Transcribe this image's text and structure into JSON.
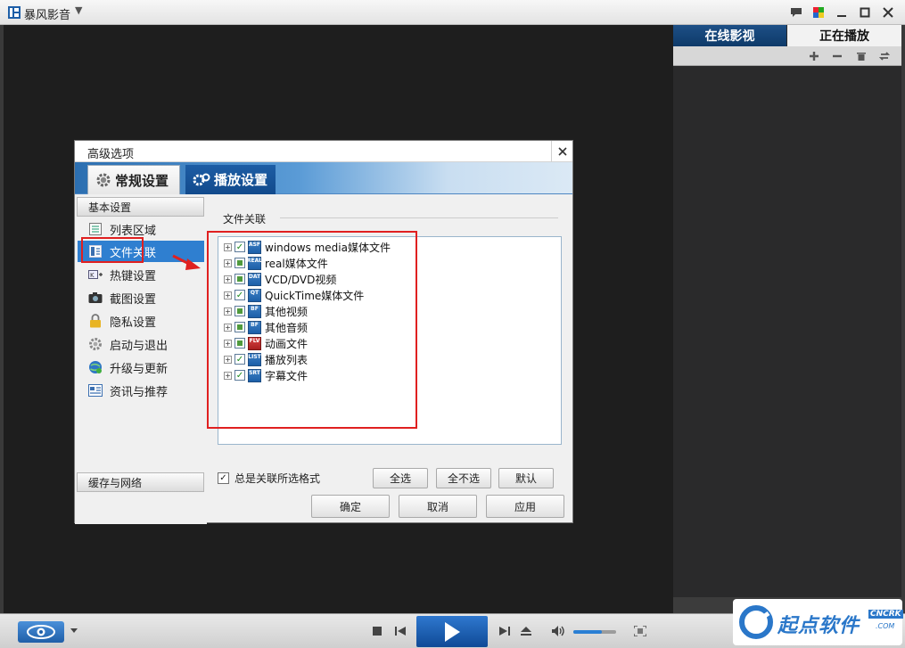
{
  "app": {
    "title": "暴风影音"
  },
  "right_panel": {
    "tabs": [
      "在线影视",
      "正在播放"
    ]
  },
  "dialog": {
    "title": "高级选项",
    "tabs": [
      "常规设置",
      "播放设置"
    ],
    "sidebar": {
      "section1": "基本设置",
      "items": [
        "列表区域",
        "文件关联",
        "热键设置",
        "截图设置",
        "隐私设置",
        "启动与退出",
        "升级与更新",
        "资讯与推荐"
      ],
      "section2": "缓存与网络"
    },
    "section_title": "文件关联",
    "tree": [
      {
        "label": "windows media媒体文件",
        "icon": "ASF",
        "state": "checked"
      },
      {
        "label": "real媒体文件",
        "icon": "REAL",
        "state": "partial"
      },
      {
        "label": "VCD/DVD视频",
        "icon": "DAT",
        "state": "partial"
      },
      {
        "label": "QuickTime媒体文件",
        "icon": "QT",
        "state": "checked"
      },
      {
        "label": "其他视频",
        "icon": "BF",
        "state": "partial"
      },
      {
        "label": "其他音频",
        "icon": "BF",
        "state": "partial"
      },
      {
        "label": "动画文件",
        "icon": "FLV",
        "state": "partial"
      },
      {
        "label": "播放列表",
        "icon": "LIST",
        "state": "checked"
      },
      {
        "label": "字幕文件",
        "icon": "SRT",
        "state": "checked"
      }
    ],
    "always_label": "总是关联所选格式",
    "buttons": {
      "select_all": "全选",
      "select_none": "全不选",
      "default": "默认",
      "ok": "确定",
      "cancel": "取消",
      "apply": "应用"
    }
  },
  "watermark": {
    "text": "起点软件",
    "badge": "CNCRK",
    "com": ".COM",
    "color": "#2a77c9"
  },
  "colors": {
    "accent": "#2f7fd0",
    "highlight": "#e02020"
  }
}
